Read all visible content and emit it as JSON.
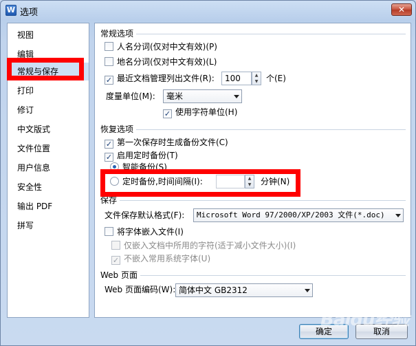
{
  "window": {
    "title": "选项",
    "app_icon_letter": "W",
    "close_label": "✕"
  },
  "sidebar": {
    "items": [
      {
        "label": "视图"
      },
      {
        "label": "编辑"
      },
      {
        "label": "常规与保存"
      },
      {
        "label": "打印"
      },
      {
        "label": "修订"
      },
      {
        "label": "中文版式"
      },
      {
        "label": "文件位置"
      },
      {
        "label": "用户信息"
      },
      {
        "label": "安全性"
      },
      {
        "label": "输出 PDF"
      },
      {
        "label": "拼写"
      }
    ],
    "selected": "常规与保存"
  },
  "general": {
    "title": "常规选项",
    "name_split": {
      "label": "人名分词(仅对中文有效)(P)",
      "checked": false
    },
    "place_split": {
      "label": "地名分词(仅对中文有效)(L)",
      "checked": false
    },
    "recent_files": {
      "label": "最近文档管理列出文件(R):",
      "checked": true,
      "value": "100",
      "unit": "个(E)"
    },
    "measure_unit": {
      "label": "度量单位(M):",
      "value": "毫米"
    },
    "char_unit": {
      "label": "使用字符单位(H)",
      "checked": true
    }
  },
  "recovery": {
    "title": "恢复选项",
    "first_backup": {
      "label": "第一次保存时生成备份文件(C)",
      "checked": true
    },
    "timed_backup": {
      "label": "启用定时备份(T)",
      "checked": true
    },
    "smart_backup": {
      "label": "智能备份(S)",
      "selected": true
    },
    "interval_backup": {
      "label": "定时备份,时间间隔(I):",
      "selected": false,
      "value": "",
      "unit": "分钟(N)"
    }
  },
  "save": {
    "title": "保存",
    "default_format": {
      "label": "文件保存默认格式(F):",
      "value": "Microsoft Word 97/2000/XP/2003 文件(*.doc)"
    },
    "embed_fonts": {
      "label": "将字体嵌入文件(I)",
      "checked": false
    },
    "embed_used_only": {
      "label": "仅嵌入文档中所用的字符(适于减小文件大小)(I)",
      "checked": false
    },
    "no_common_fonts": {
      "label": "不嵌入常用系统字体(U)",
      "checked": true
    }
  },
  "web": {
    "title": "Web 页面",
    "encoding": {
      "label": "Web 页面编码(W):",
      "value": "简体中文 GB2312"
    }
  },
  "buttons": {
    "ok": "确定",
    "cancel": "取消"
  },
  "watermark": "Baidu经验",
  "colors": {
    "highlight": "#ff0000",
    "selected_row": "#cde0f5",
    "window_bg": "#c5d7ee"
  }
}
